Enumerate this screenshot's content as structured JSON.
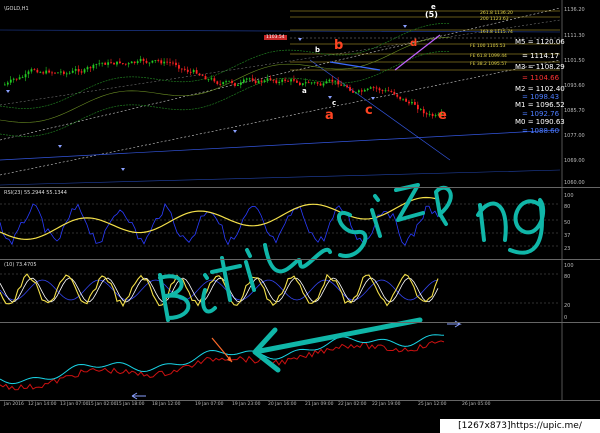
{
  "chart": {
    "symbol_header": "\\GOLD,H1",
    "rsi_header": "RSI(23) 55.2944 55.1344",
    "stoch_header": "(10) 73.4705",
    "bottom_header": ""
  },
  "price_scale": [
    "1136.20",
    "1111.30",
    "1101.50",
    "1093.60",
    "1085.70",
    "1077.00",
    "1069.00",
    "1060.00"
  ],
  "rsi_scale": [
    "100",
    "80",
    "50",
    "37",
    "23"
  ],
  "stoch_scale": [
    "100",
    "80",
    "20",
    "0"
  ],
  "levels": {
    "right_panel": [
      {
        "text": "M5 = 1120.06",
        "color": "#ffffff"
      },
      {
        "text": "= 1114.17",
        "color": "#ffffff"
      },
      {
        "text": "M3 = 1108.29",
        "color": "#ffffff"
      },
      {
        "text": "= 1104.66",
        "color": "#ff3333"
      },
      {
        "text": "M2 = 1102.40",
        "color": "#ffffff"
      },
      {
        "text": "= 1098.43",
        "color": "#4d7dff"
      },
      {
        "text": "M1 = 1096.52",
        "color": "#ffffff"
      },
      {
        "text": "= 1092.76",
        "color": "#4d7dff"
      },
      {
        "text": "M0 = 1090.63",
        "color": "#ffffff"
      },
      {
        "text": "= 1088.60",
        "color": "#4d7dff"
      }
    ],
    "fib_labels": [
      "261.8  1136.20",
      "200  1123.63",
      "161.8  1115.74",
      "FE 100  1105.53",
      "FE 61.8  1099.44",
      "FE 38.2  1095.57"
    ],
    "red_box": "1103.54"
  },
  "wave_labels": {
    "top": "(5)",
    "top_small": "e",
    "b": "b",
    "a": "a",
    "c": "c",
    "e": "e",
    "d": "d",
    "small_a": "a",
    "small_c": "c",
    "small_b": "b"
  },
  "handwriting": "Btl:m si3ng",
  "time_axis": [
    "Jan 2016",
    "12 Jan 14:00",
    "13 Jan 07:00",
    "15 Jan 02:00",
    "15 Jan 18:00",
    "18 Jan 12:00",
    "19 Jan 07:00",
    "19 Jan 23:00",
    "20 Jan 16:00",
    "21 Jan 09:00",
    "22 Jan 02:00",
    "22 Jan 19:00",
    "25 Jan 12:00",
    "26 Jan 05:00"
  ],
  "badge": "[1267x873]https://upic.me/",
  "colors": {
    "bull": "#22cc22",
    "bear": "#ff2222",
    "rsi": "#f4e04a",
    "hand": "#10b6a8"
  }
}
